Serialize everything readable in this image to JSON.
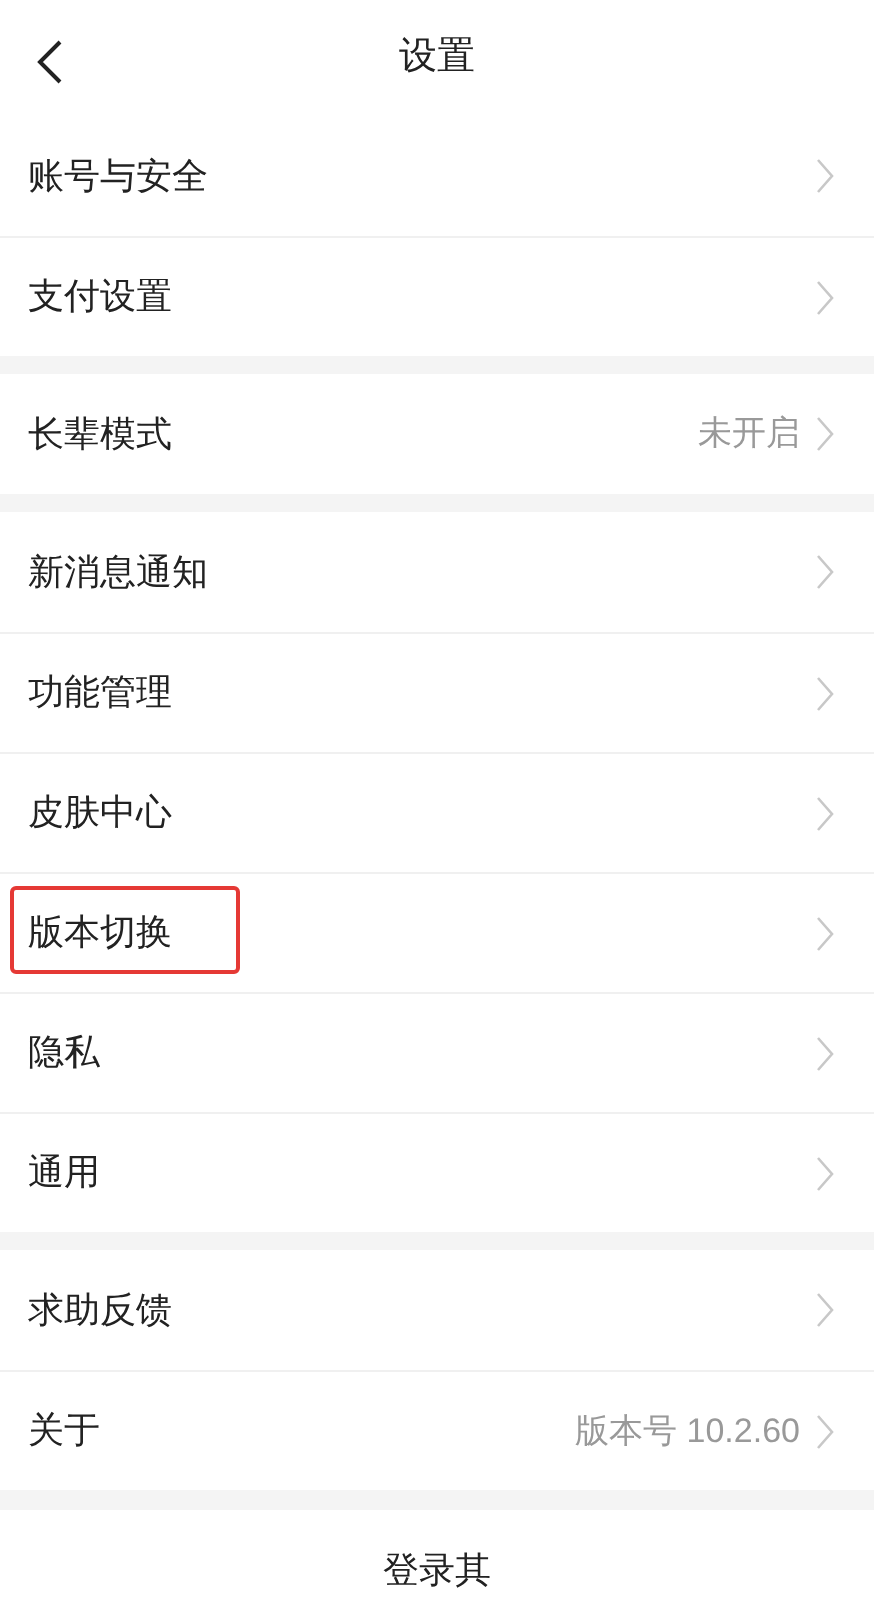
{
  "header": {
    "title": "设置"
  },
  "groups": [
    {
      "items": [
        {
          "label": "账号与安全",
          "highlighted": false
        },
        {
          "label": "支付设置",
          "highlighted": false
        }
      ]
    },
    {
      "items": [
        {
          "label": "长辈模式",
          "value": "未开启",
          "highlighted": false
        }
      ]
    },
    {
      "items": [
        {
          "label": "新消息通知",
          "highlighted": false
        },
        {
          "label": "功能管理",
          "highlighted": false
        },
        {
          "label": "皮肤中心",
          "highlighted": false
        },
        {
          "label": "版本切换",
          "highlighted": true
        },
        {
          "label": "隐私",
          "highlighted": false
        },
        {
          "label": "通用",
          "highlighted": false
        }
      ]
    },
    {
      "items": [
        {
          "label": "求助反馈",
          "highlighted": false
        },
        {
          "label": "关于",
          "value": "版本号 10.2.60",
          "highlighted": false
        }
      ]
    }
  ],
  "bottom_button": "登录其"
}
